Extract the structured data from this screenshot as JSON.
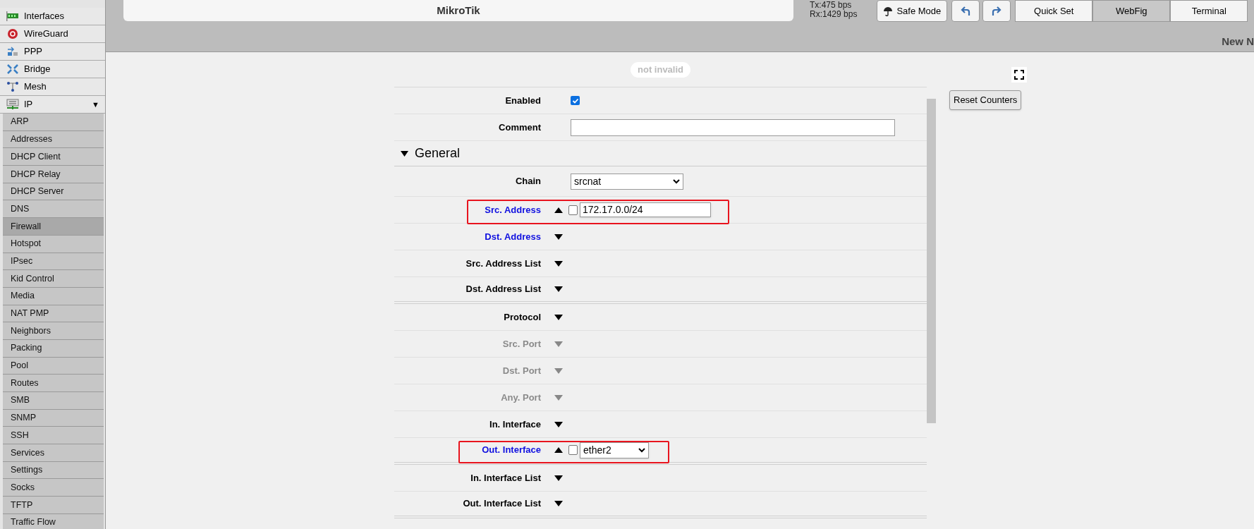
{
  "sidebar": {
    "items": [
      {
        "label": "Interfaces"
      },
      {
        "label": "WireGuard"
      },
      {
        "label": "PPP"
      },
      {
        "label": "Bridge"
      },
      {
        "label": "Mesh"
      },
      {
        "label": "IP",
        "expanded": true,
        "arrow": "▼",
        "children": [
          {
            "label": "ARP",
            "selected": false
          },
          {
            "label": "Addresses",
            "selected": false
          },
          {
            "label": "DHCP Client",
            "selected": false
          },
          {
            "label": "DHCP Relay",
            "selected": false
          },
          {
            "label": "DHCP Server",
            "selected": false
          },
          {
            "label": "DNS",
            "selected": false
          },
          {
            "label": "Firewall",
            "selected": true
          },
          {
            "label": "Hotspot",
            "selected": false
          },
          {
            "label": "IPsec",
            "selected": false
          },
          {
            "label": "Kid Control",
            "selected": false
          },
          {
            "label": "Media",
            "selected": false
          },
          {
            "label": "NAT PMP",
            "selected": false
          },
          {
            "label": "Neighbors",
            "selected": false
          },
          {
            "label": "Packing",
            "selected": false
          },
          {
            "label": "Pool",
            "selected": false
          },
          {
            "label": "Routes",
            "selected": false
          },
          {
            "label": "SMB",
            "selected": false
          },
          {
            "label": "SNMP",
            "selected": false
          },
          {
            "label": "SSH",
            "selected": false
          },
          {
            "label": "Services",
            "selected": false
          },
          {
            "label": "Settings",
            "selected": false
          },
          {
            "label": "Socks",
            "selected": false
          },
          {
            "label": "TFTP",
            "selected": false
          },
          {
            "label": "Traffic Flow",
            "selected": false
          }
        ]
      }
    ]
  },
  "header": {
    "title": "MikroTik",
    "tx": "Tx:475 bps",
    "rx": "Rx:1429 bps",
    "safe_mode": "Safe Mode",
    "tabs": [
      {
        "label": "Quick Set",
        "selected": false
      },
      {
        "label": "WebFig",
        "selected": true
      },
      {
        "label": "Terminal",
        "selected": false
      }
    ],
    "page_title": "New N"
  },
  "form": {
    "status": "not invalid",
    "reset_button": "Reset Counters",
    "top_rows": [
      {
        "label": "Enabled",
        "kind": "checkbox",
        "checked": true
      },
      {
        "label": "Comment",
        "kind": "textarea"
      }
    ],
    "section": {
      "title": "General",
      "expanded": true,
      "groups": [
        [
          {
            "label": "Chain",
            "kind": "select",
            "value": "srcnat"
          },
          {
            "label": "Src. Address",
            "kind": "optional",
            "set": true,
            "disabled": false,
            "expanded": true,
            "negated": false,
            "field": {
              "kind": "text",
              "value": "172.17.0.0/24"
            },
            "highlighted": true
          },
          {
            "label": "Dst. Address",
            "kind": "optional",
            "set": true,
            "disabled": false,
            "expanded": false
          },
          {
            "label": "Src. Address List",
            "kind": "optional",
            "set": false,
            "disabled": false,
            "expanded": false
          },
          {
            "label": "Dst. Address List",
            "kind": "optional",
            "set": false,
            "disabled": false,
            "expanded": false
          }
        ],
        [
          {
            "label": "Protocol",
            "kind": "optional",
            "set": false,
            "disabled": false,
            "expanded": false
          },
          {
            "label": "Src. Port",
            "kind": "optional",
            "set": false,
            "disabled": true,
            "expanded": false
          },
          {
            "label": "Dst. Port",
            "kind": "optional",
            "set": false,
            "disabled": true,
            "expanded": false
          },
          {
            "label": "Any. Port",
            "kind": "optional",
            "set": false,
            "disabled": true,
            "expanded": false
          },
          {
            "label": "In. Interface",
            "kind": "optional",
            "set": false,
            "disabled": false,
            "expanded": false
          },
          {
            "label": "Out. Interface",
            "kind": "optional",
            "set": true,
            "disabled": false,
            "expanded": true,
            "negated": false,
            "field": {
              "kind": "select",
              "value": "ether2"
            },
            "highlighted": true
          }
        ],
        [
          {
            "label": "In. Interface List",
            "kind": "optional",
            "set": false,
            "disabled": false,
            "expanded": false
          },
          {
            "label": "Out. Interface List",
            "kind": "optional",
            "set": false,
            "disabled": false,
            "expanded": false
          }
        ]
      ]
    }
  }
}
